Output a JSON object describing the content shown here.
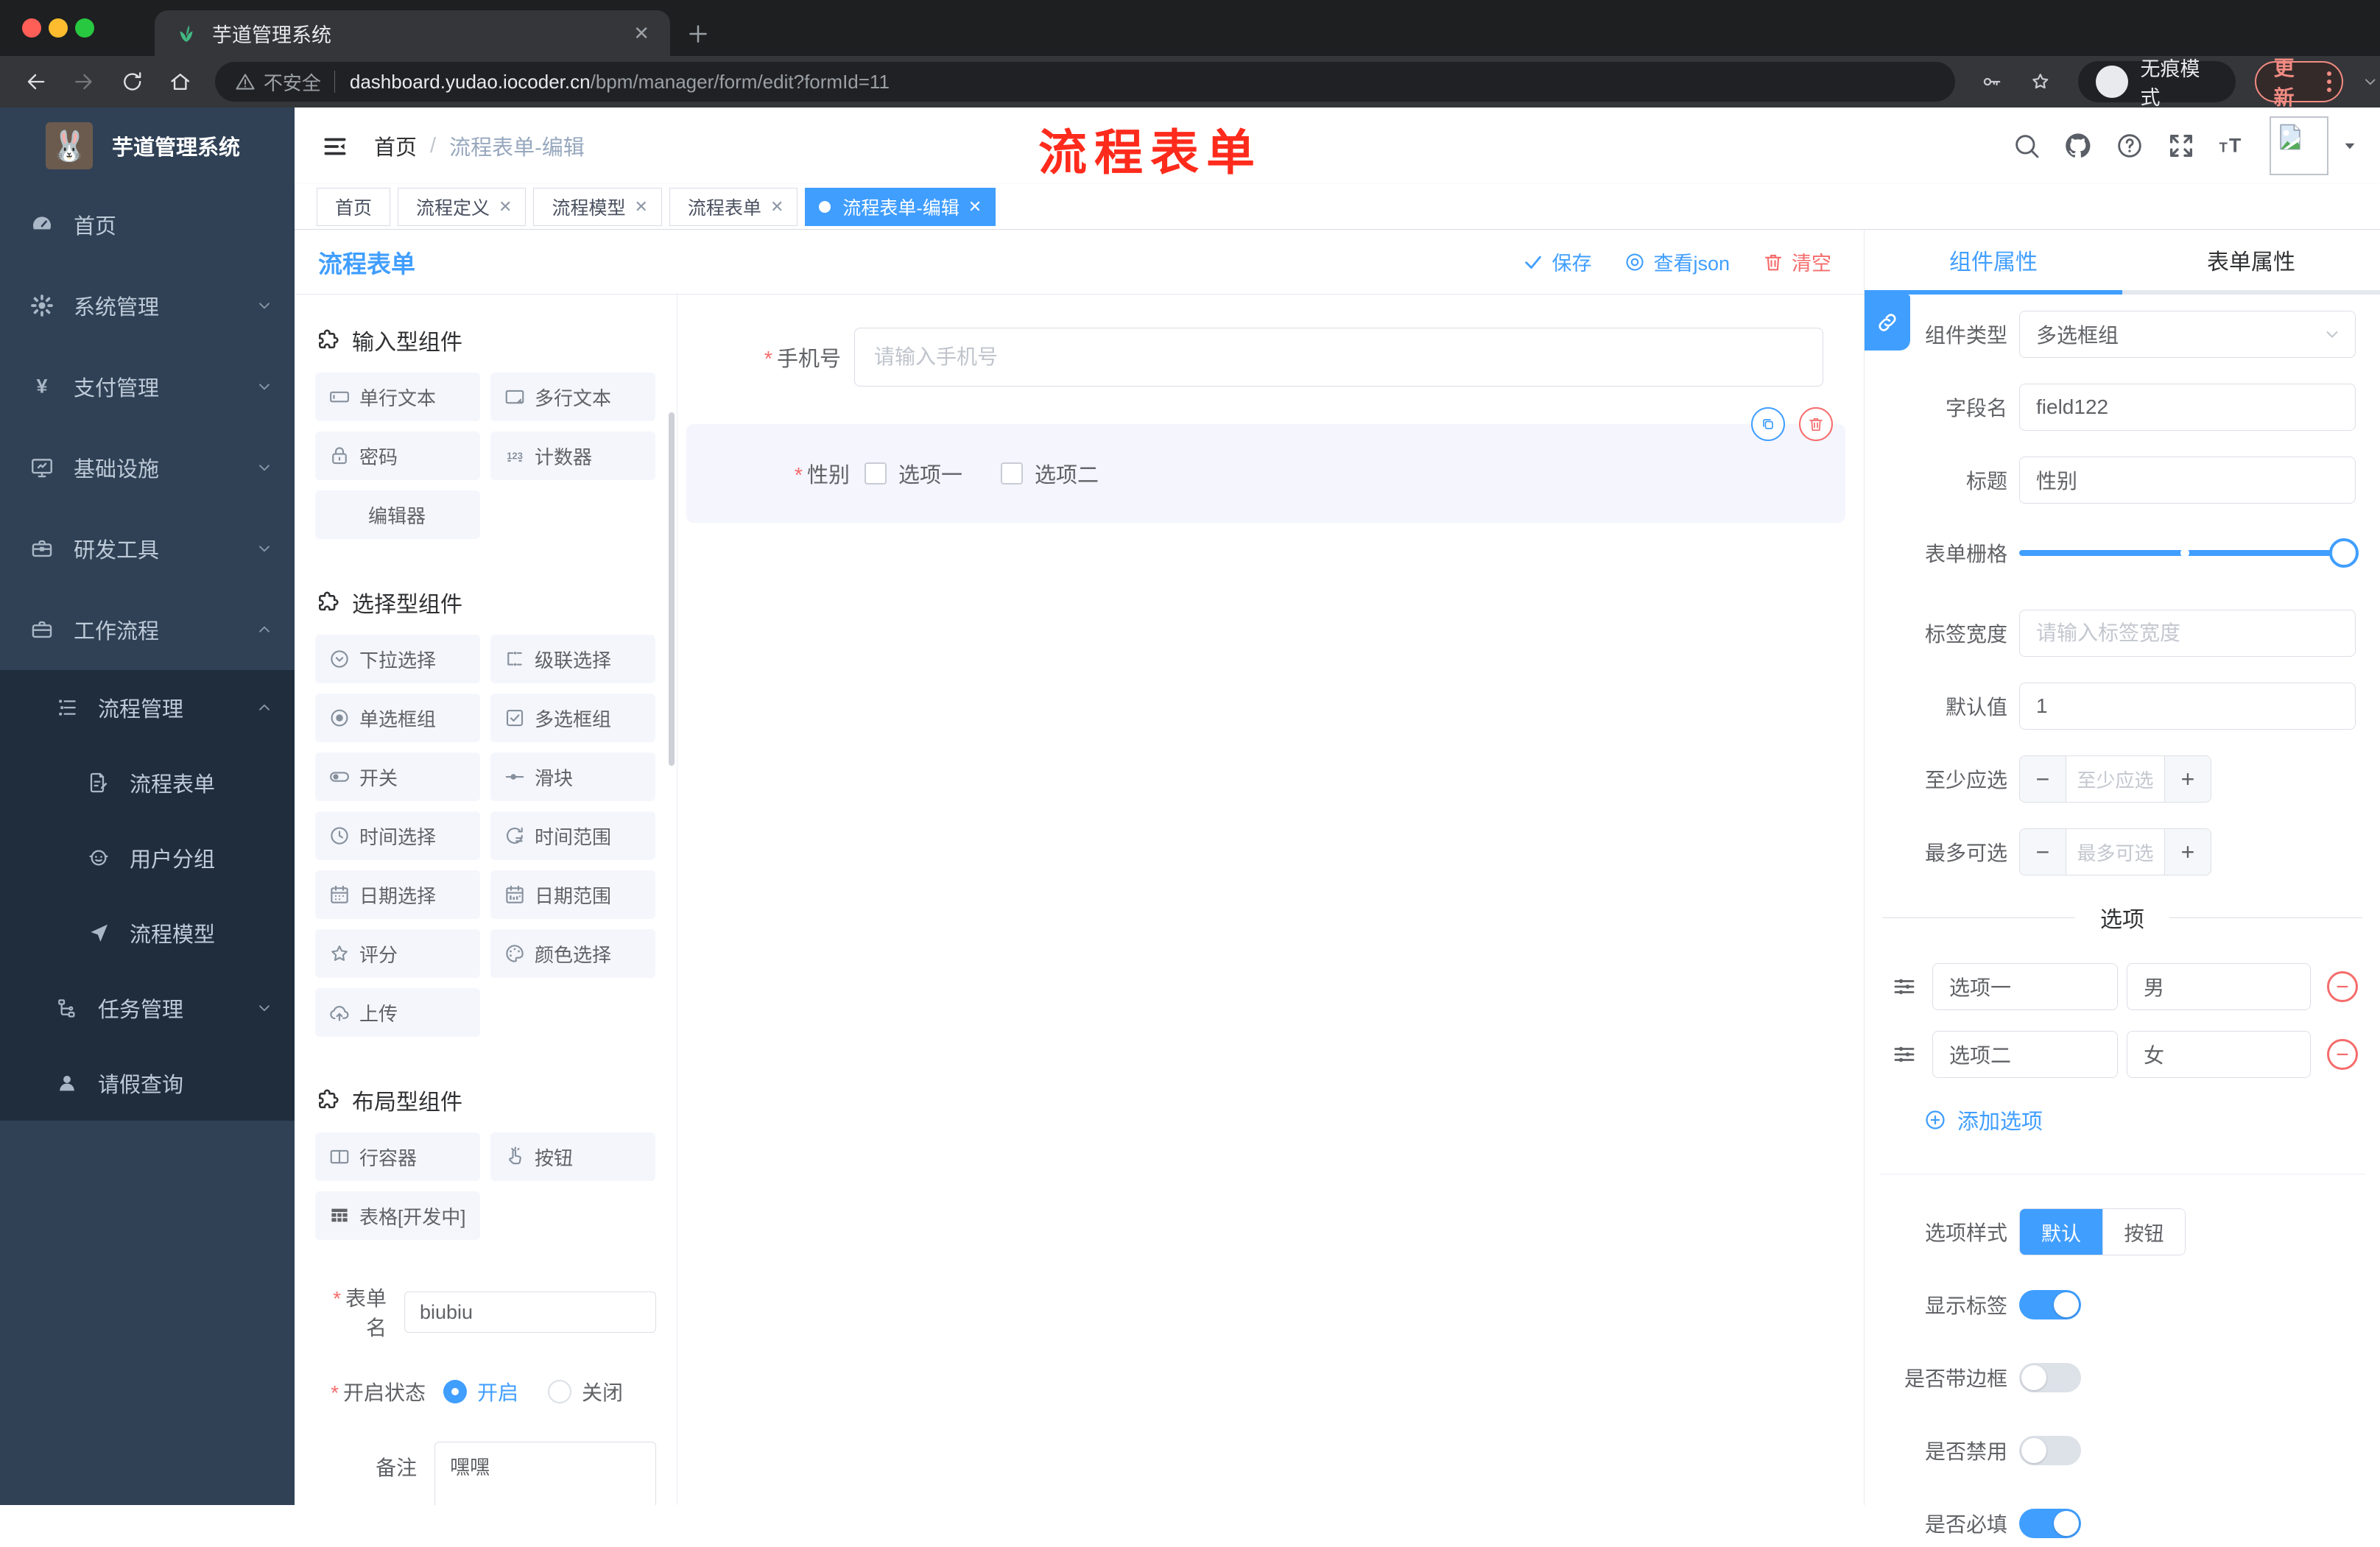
{
  "colors": {
    "accent": "#409eff",
    "danger": "#f56c6c",
    "sidebar_bg": "#304156",
    "submenu_bg": "#1f2d3d",
    "annotation_red": "#fe2b1c"
  },
  "browser": {
    "tab_title": "芋道管理系统",
    "security_label": "不安全",
    "url_host": "dashboard.yudao.iocoder.cn",
    "url_path": "/bpm/manager/form/edit?formId=11",
    "incognito_label": "无痕模式",
    "update_label": "更新"
  },
  "sidebar": {
    "title": "芋道管理系统",
    "items": [
      {
        "label": "首页",
        "icon": "dashboard-icon",
        "expandable": false
      },
      {
        "label": "系统管理",
        "icon": "gear-icon",
        "expandable": true
      },
      {
        "label": "支付管理",
        "icon": "yen-icon",
        "expandable": true
      },
      {
        "label": "基础设施",
        "icon": "monitor-icon",
        "expandable": true
      },
      {
        "label": "研发工具",
        "icon": "toolbox-icon",
        "expandable": true
      },
      {
        "label": "工作流程",
        "icon": "briefcase-icon",
        "expandable": true,
        "expanded": true
      }
    ],
    "submenu": {
      "group_label": "流程管理",
      "group_icon": "list-icon",
      "children": [
        {
          "label": "流程表单",
          "icon": "form-doc-icon"
        },
        {
          "label": "用户分组",
          "icon": "user-group-icon"
        },
        {
          "label": "流程模型",
          "icon": "paper-plane-icon"
        }
      ],
      "siblings": [
        {
          "label": "任务管理",
          "icon": "tree-icon",
          "expandable": true
        },
        {
          "label": "请假查询",
          "icon": "person-icon"
        }
      ]
    }
  },
  "navbar": {
    "breadcrumb_home": "首页",
    "breadcrumb_current": "流程表单-编辑",
    "overlay_annotation": "流程表单"
  },
  "tags": [
    {
      "label": "首页",
      "closable": false,
      "active": false
    },
    {
      "label": "流程定义",
      "closable": true,
      "active": false
    },
    {
      "label": "流程模型",
      "closable": true,
      "active": false
    },
    {
      "label": "流程表单",
      "closable": true,
      "active": false
    },
    {
      "label": "流程表单-编辑",
      "closable": true,
      "active": true
    }
  ],
  "designer": {
    "title": "流程表单",
    "save_label": "保存",
    "view_json_label": "查看json",
    "clear_label": "清空",
    "palette": {
      "sections": [
        {
          "title": "输入型组件",
          "items": [
            {
              "label": "单行文本",
              "icon": "input-icon"
            },
            {
              "label": "多行文本",
              "icon": "textarea-icon"
            },
            {
              "label": "密码",
              "icon": "lock-icon"
            },
            {
              "label": "计数器",
              "icon": "counter-icon"
            },
            {
              "label": "编辑器",
              "icon": ""
            }
          ]
        },
        {
          "title": "选择型组件",
          "items": [
            {
              "label": "下拉选择",
              "icon": "select-icon"
            },
            {
              "label": "级联选择",
              "icon": "cascader-icon"
            },
            {
              "label": "单选框组",
              "icon": "radio-icon"
            },
            {
              "label": "多选框组",
              "icon": "checkbox-icon"
            },
            {
              "label": "开关",
              "icon": "switch-icon"
            },
            {
              "label": "滑块",
              "icon": "slider-icon"
            },
            {
              "label": "时间选择",
              "icon": "time-icon"
            },
            {
              "label": "时间范围",
              "icon": "time-range-icon"
            },
            {
              "label": "日期选择",
              "icon": "date-icon"
            },
            {
              "label": "日期范围",
              "icon": "date-range-icon"
            },
            {
              "label": "评分",
              "icon": "rate-icon"
            },
            {
              "label": "颜色选择",
              "icon": "color-icon"
            },
            {
              "label": "上传",
              "icon": "upload-icon"
            }
          ]
        },
        {
          "title": "布局型组件",
          "items": [
            {
              "label": "行容器",
              "icon": "row-icon"
            },
            {
              "label": "按钮",
              "icon": "button-icon"
            },
            {
              "label": "表格[开发中]",
              "icon": "table-icon"
            }
          ]
        }
      ]
    },
    "meta": {
      "form_name_label": "表单名",
      "form_name_value": "biubiu",
      "status_label": "开启状态",
      "status_on": "开启",
      "status_off": "关闭",
      "remark_label": "备注",
      "remark_value": "嘿嘿"
    },
    "canvas": {
      "phone_label": "手机号",
      "phone_placeholder": "请输入手机号",
      "gender_label": "性别",
      "gender_options": [
        "选项一",
        "选项二"
      ]
    }
  },
  "properties": {
    "tab_component": "组件属性",
    "tab_form": "表单属性",
    "component_type_label": "组件类型",
    "component_type_value": "多选框组",
    "field_name_label": "字段名",
    "field_name_value": "field122",
    "title_label": "标题",
    "title_value": "性别",
    "grid_label": "表单栅格",
    "label_width_label": "标签宽度",
    "label_width_placeholder": "请输入标签宽度",
    "default_label": "默认值",
    "default_value": "1",
    "min_label": "至少应选",
    "min_placeholder": "至少应选",
    "max_label": "最多可选",
    "max_placeholder": "最多可选",
    "options_divider": "选项",
    "options": [
      {
        "label": "选项一",
        "value": "男"
      },
      {
        "label": "选项二",
        "value": "女"
      }
    ],
    "add_option_label": "添加选项",
    "style_label": "选项样式",
    "style_default": "默认",
    "style_button": "按钮",
    "switch_show_label": "显示标签",
    "switch_border_label": "是否带边框",
    "switch_disabled_label": "是否禁用",
    "switch_required_label": "是否必填",
    "switch_show_on": true,
    "switch_border_on": false,
    "switch_disabled_on": false,
    "switch_required_on": true
  }
}
